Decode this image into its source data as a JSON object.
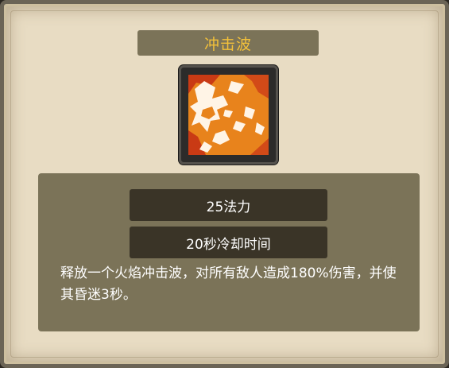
{
  "skill": {
    "title": "冲击波",
    "icon": "shockwave-flame-icon",
    "mana_cost": "25法力",
    "cooldown": "20秒冷却时间",
    "description": "释放一个火焰冲击波，对所有敌人造成180%伤害，并使其昏迷3秒。"
  },
  "colors": {
    "title_text": "#f3c13a",
    "panel": "#7b7358",
    "stat_bar": "#3a3427",
    "parchment": "#e8dcc3",
    "icon_orange": "#e8831c"
  }
}
